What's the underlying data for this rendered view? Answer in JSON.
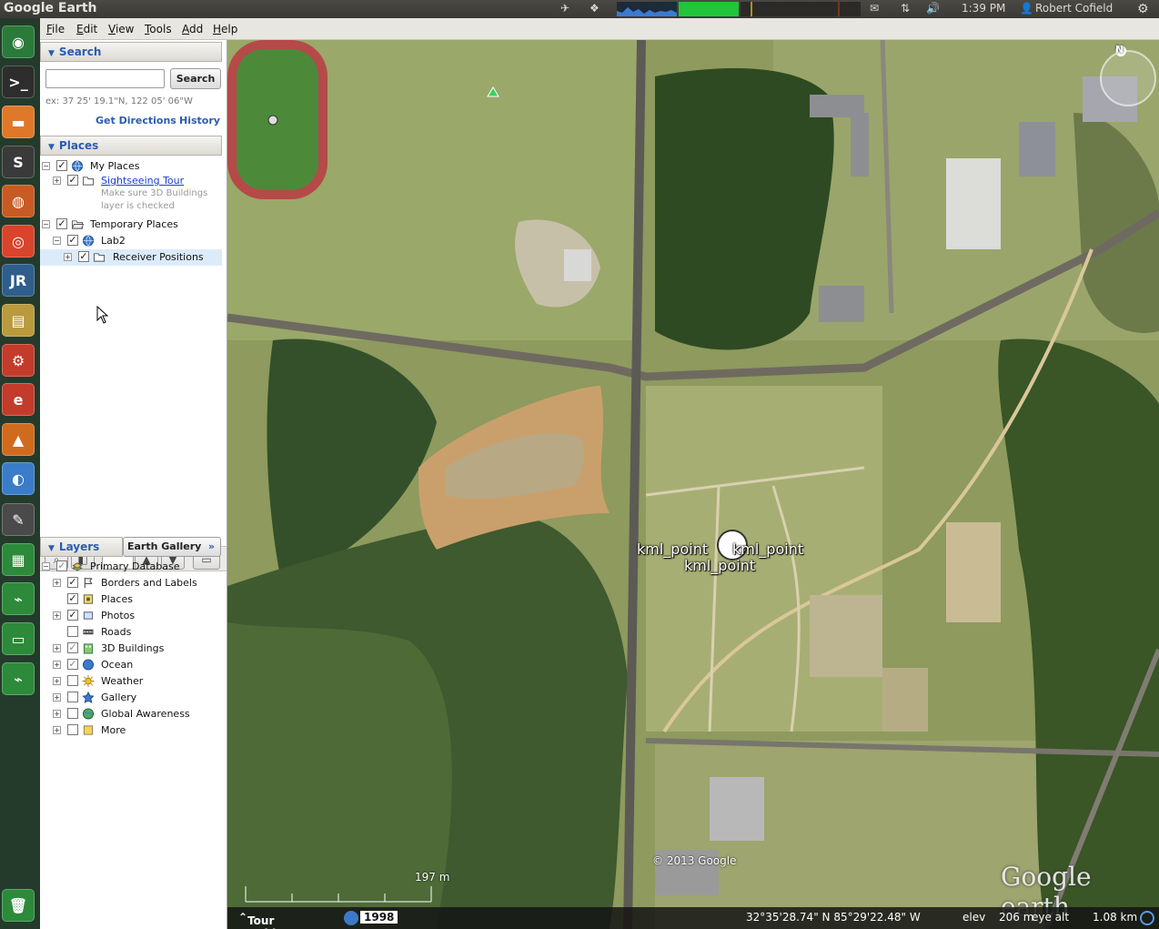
{
  "topbar": {
    "app_title": "Google Earth",
    "time": "1:39 PM",
    "user": "Robert Cofield"
  },
  "menu": {
    "file": "File",
    "edit": "Edit",
    "view": "View",
    "tools": "Tools",
    "add": "Add",
    "help": "Help"
  },
  "search": {
    "header": "Search",
    "placeholder": "",
    "button": "Search",
    "example": "ex: 37 25' 19.1\"N, 122 05' 06\"W",
    "get_directions": "Get Directions",
    "history": "History"
  },
  "places": {
    "header": "Places",
    "items": [
      {
        "label": "My Places"
      },
      {
        "label": "Sightseeing Tour",
        "note": "Make sure 3D Buildings layer is checked"
      },
      {
        "label": "Temporary Places"
      },
      {
        "label": "Lab2"
      },
      {
        "label": "Receiver Positions"
      }
    ]
  },
  "layers": {
    "header": "Layers",
    "gallery": "Earth Gallery",
    "gallery_chevron": "»",
    "items": [
      {
        "label": "Primary Database"
      },
      {
        "label": "Borders and Labels"
      },
      {
        "label": "Places"
      },
      {
        "label": "Photos"
      },
      {
        "label": "Roads"
      },
      {
        "label": "3D Buildings"
      },
      {
        "label": "Ocean"
      },
      {
        "label": "Weather"
      },
      {
        "label": "Gallery"
      },
      {
        "label": "Global Awareness"
      },
      {
        "label": "More"
      }
    ]
  },
  "map": {
    "kml_label": "kml_point",
    "copyright": "© 2013 Google",
    "scale": "197 m",
    "brand": "Google earth",
    "north": "N"
  },
  "status": {
    "tour_guide": "Tour Guide",
    "year": "1998",
    "coords": "32°35'28.74\" N   85°29'22.48\" W",
    "elev_label": "elev",
    "elev": "206 m",
    "eye_label": "eye alt",
    "eye": "1.08 km"
  },
  "colors": {
    "link": "#2a5db0",
    "launcher_bg": "#243b2c"
  }
}
